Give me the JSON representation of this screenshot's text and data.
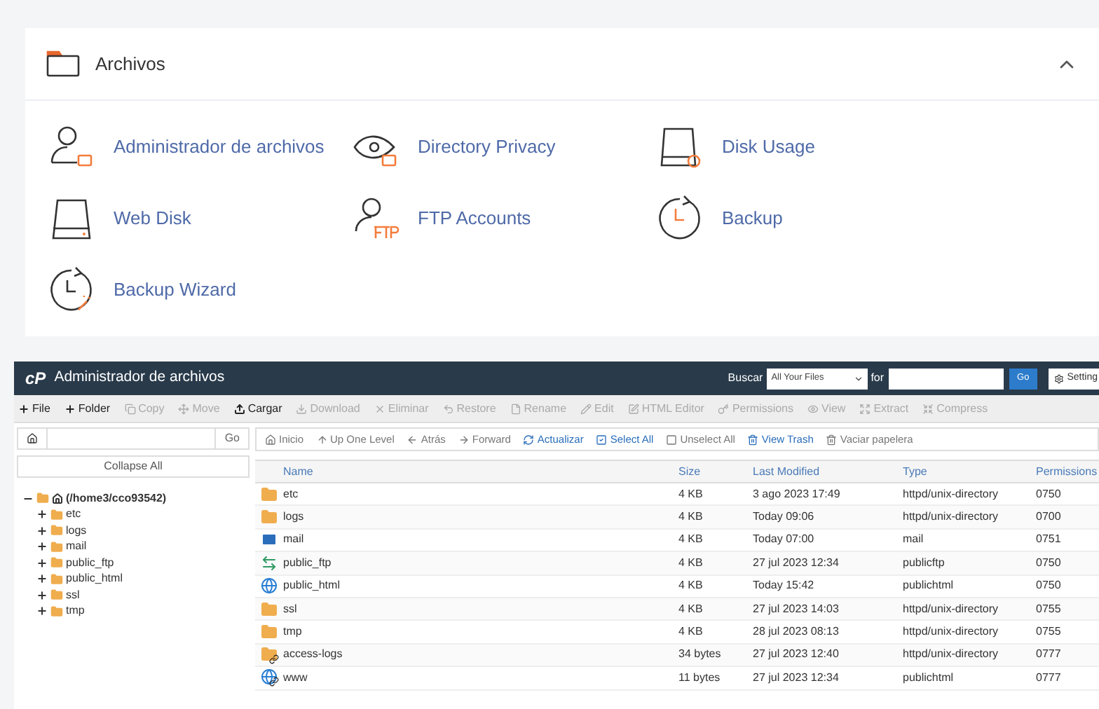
{
  "section": {
    "title": "Archivos",
    "expanded": true,
    "items": [
      {
        "label": "Administrador de archivos",
        "kind": "file-manager"
      },
      {
        "label": "Directory Privacy",
        "kind": "privacy"
      },
      {
        "label": "Disk Usage",
        "kind": "disk-usage"
      },
      {
        "label": "Web Disk",
        "kind": "web-disk"
      },
      {
        "label": "FTP Accounts",
        "kind": "ftp"
      },
      {
        "label": "Backup",
        "kind": "backup"
      },
      {
        "label": "Backup Wizard",
        "kind": "backup-wizard"
      }
    ]
  },
  "file_manager": {
    "title": "Administrador de archivos",
    "logo": "cP",
    "search": {
      "label": "Buscar",
      "scope": "All Your Files",
      "for_label": "for",
      "go": "Go",
      "settings": "Setting"
    },
    "toolbar": [
      {
        "label": "File",
        "disabled": false
      },
      {
        "label": "Folder",
        "disabled": false
      },
      {
        "label": "Copy",
        "disabled": true
      },
      {
        "label": "Move",
        "disabled": true
      },
      {
        "label": "Cargar",
        "disabled": false
      },
      {
        "label": "Download",
        "disabled": true
      },
      {
        "label": "Eliminar",
        "disabled": true
      },
      {
        "label": "Restore",
        "disabled": true
      },
      {
        "label": "Rename",
        "disabled": true
      },
      {
        "label": "Edit",
        "disabled": true
      },
      {
        "label": "HTML Editor",
        "disabled": true
      },
      {
        "label": "Permissions",
        "disabled": true
      },
      {
        "label": "View",
        "disabled": true
      },
      {
        "label": "Extract",
        "disabled": true
      },
      {
        "label": "Compress",
        "disabled": true
      }
    ],
    "path_go": "Go",
    "collapse_all": "Collapse All",
    "tree": [
      {
        "label": "(/home3/cco93542)",
        "expanded": true,
        "children": [
          {
            "label": "etc",
            "expanded": false
          },
          {
            "label": "logs",
            "expanded": false
          },
          {
            "label": "mail",
            "expanded": false
          },
          {
            "label": "public_ftp",
            "expanded": false
          },
          {
            "label": "public_html",
            "expanded": false
          },
          {
            "label": "ssl",
            "expanded": false
          },
          {
            "label": "tmp",
            "expanded": false
          }
        ]
      }
    ],
    "nav": [
      {
        "label": "Inicio",
        "link": false
      },
      {
        "label": "Up One Level",
        "link": false
      },
      {
        "label": "Atrás",
        "link": false
      },
      {
        "label": "Forward",
        "link": false
      },
      {
        "label": "Actualizar",
        "link": true
      },
      {
        "label": "Select All",
        "link": true
      },
      {
        "label": "Unselect All",
        "link": false
      },
      {
        "label": "View Trash",
        "link": true
      },
      {
        "label": "Vaciar papelera",
        "link": false
      }
    ],
    "table": {
      "columns": [
        "Name",
        "Size",
        "Last Modified",
        "Type",
        "Permissions"
      ],
      "rows": [
        {
          "kind": "folder",
          "name": "etc",
          "size": "4 KB",
          "modified": "3 ago 2023 17:49",
          "type": "httpd/unix-directory",
          "perms": "0750"
        },
        {
          "kind": "folder",
          "name": "logs",
          "size": "4 KB",
          "modified": "Today 09:06",
          "type": "httpd/unix-directory",
          "perms": "0700"
        },
        {
          "kind": "mail",
          "name": "mail",
          "size": "4 KB",
          "modified": "Today 07:00",
          "type": "mail",
          "perms": "0751"
        },
        {
          "kind": "ftp",
          "name": "public_ftp",
          "size": "4 KB",
          "modified": "27 jul 2023 12:34",
          "type": "publicftp",
          "perms": "0750"
        },
        {
          "kind": "globe",
          "name": "public_html",
          "size": "4 KB",
          "modified": "Today 15:42",
          "type": "publichtml",
          "perms": "0750"
        },
        {
          "kind": "folder",
          "name": "ssl",
          "size": "4 KB",
          "modified": "27 jul 2023 14:03",
          "type": "httpd/unix-directory",
          "perms": "0755"
        },
        {
          "kind": "folder",
          "name": "tmp",
          "size": "4 KB",
          "modified": "28 jul 2023 08:13",
          "type": "httpd/unix-directory",
          "perms": "0755"
        },
        {
          "kind": "folder-link",
          "name": "access-logs",
          "size": "34 bytes",
          "modified": "27 jul 2023 12:40",
          "type": "httpd/unix-directory",
          "perms": "0777"
        },
        {
          "kind": "globe-link",
          "name": "www",
          "size": "11 bytes",
          "modified": "27 jul 2023 12:34",
          "type": "publichtml",
          "perms": "0777"
        }
      ]
    }
  }
}
